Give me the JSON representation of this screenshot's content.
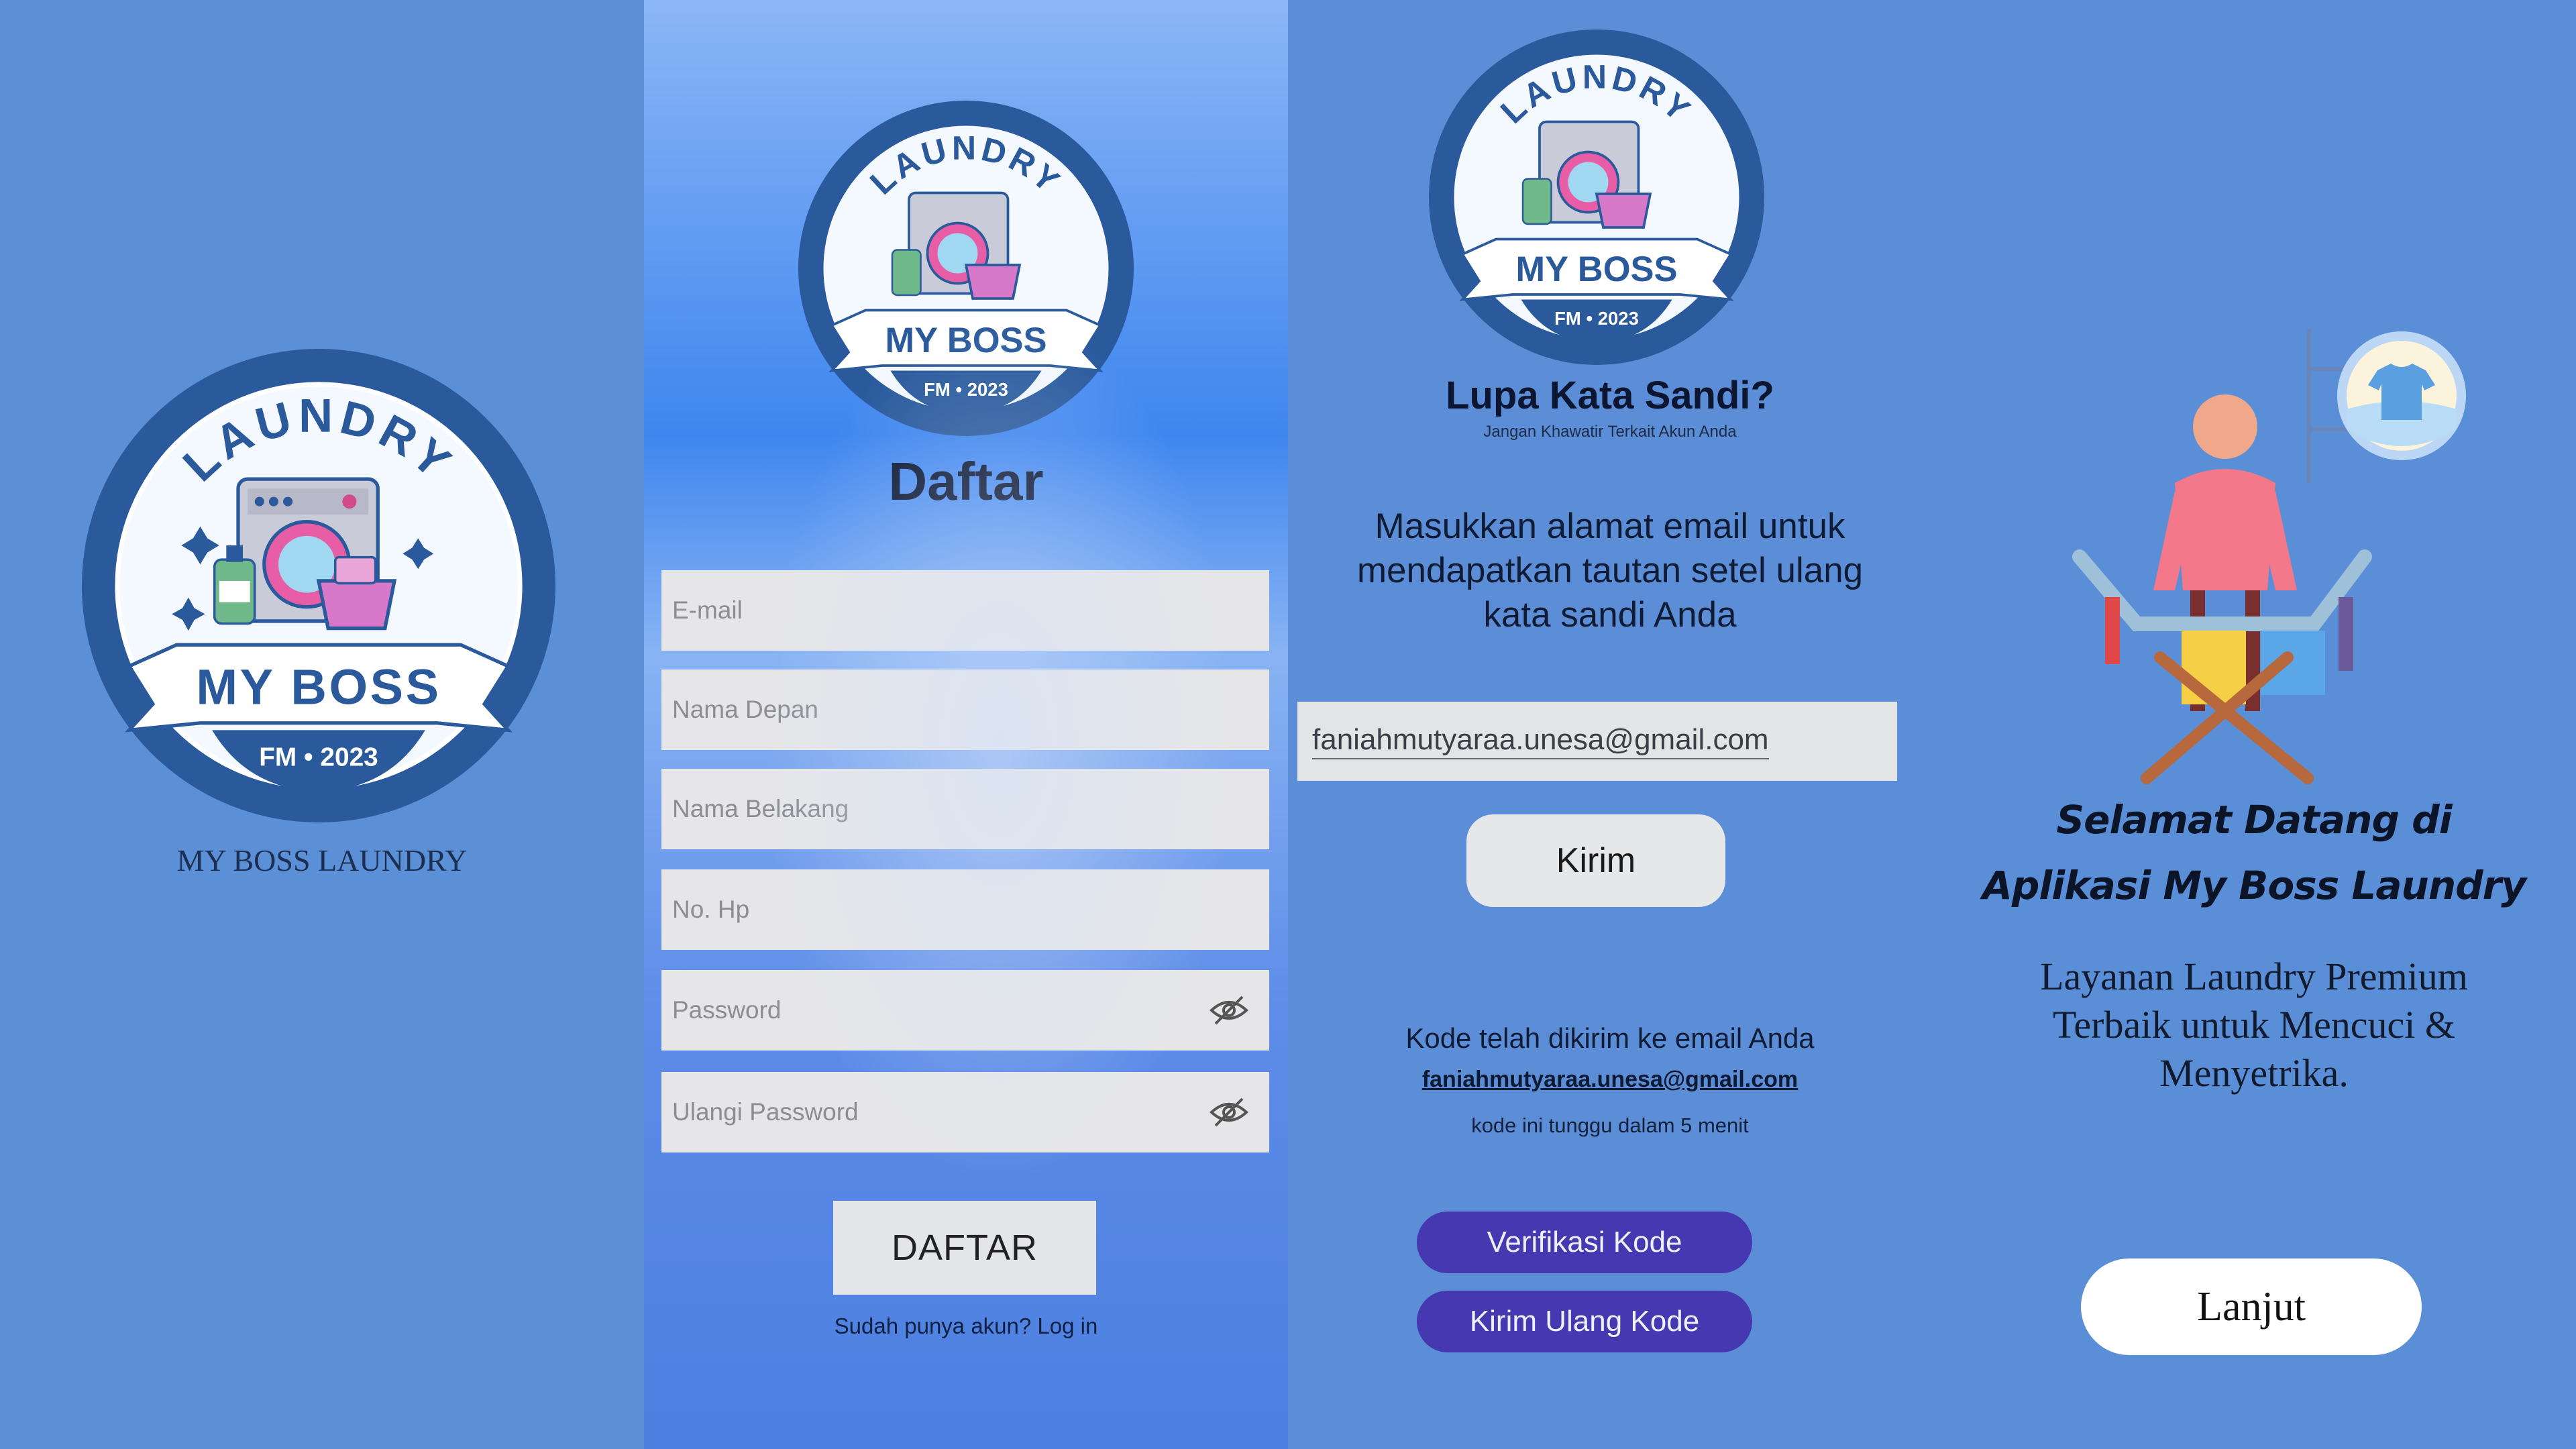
{
  "splash": {
    "logo": {
      "top_text": "LAUNDRY",
      "banner_text": "MY BOSS",
      "bottom_text": "FM • 2023",
      "icon": "washing-machine-icon"
    },
    "caption": "MY BOSS LAUNDRY"
  },
  "register": {
    "title": "Daftar",
    "fields": [
      {
        "placeholder": "E-mail"
      },
      {
        "placeholder": "Nama Depan"
      },
      {
        "placeholder": "Nama Belakang"
      },
      {
        "placeholder": "No. Hp"
      },
      {
        "placeholder": "Password",
        "icon": "eye-off-icon"
      },
      {
        "placeholder": "Ulangi Password",
        "icon": "eye-off-icon"
      }
    ],
    "submit_label": "DAFTAR",
    "login_link": "Sudah punya akun? Log in"
  },
  "forgot": {
    "title": "Lupa Kata Sandi?",
    "subtitle": "Jangan Khawatir Terkait Akun Anda",
    "instruction": "Masukkan alamat email untuk mendapatkan tautan setel ulang kata sandi Anda",
    "email_value": "faniahmutyaraa.unesa@gmail.com",
    "send_label": "Kirim",
    "code_sent": "Kode telah dikirim ke email Anda",
    "code_email": "faniahmutyaraa.unesa@gmail.com",
    "timer_note": "kode ini tunggu dalam 5 menit",
    "verify_label": "Verifikasi Kode",
    "resend_label": "Kirim Ulang Kode"
  },
  "onboarding": {
    "heading_line1": "Selamat Datang di",
    "heading_line2": "Aplikasi My Boss Laundry",
    "description": "Layanan Laundry Premium Terbaik untuk Mencuci & Menyetrika.",
    "continue_label": "Lanjut",
    "illustration": "person-ironing-icon",
    "badge_icon": "shirt-icon"
  },
  "colors": {
    "background_blue": "#5b8fd6",
    "logo_navy": "#2a5a9c",
    "pill_purple": "#4538b0",
    "logo_pink": "#d878c8"
  }
}
